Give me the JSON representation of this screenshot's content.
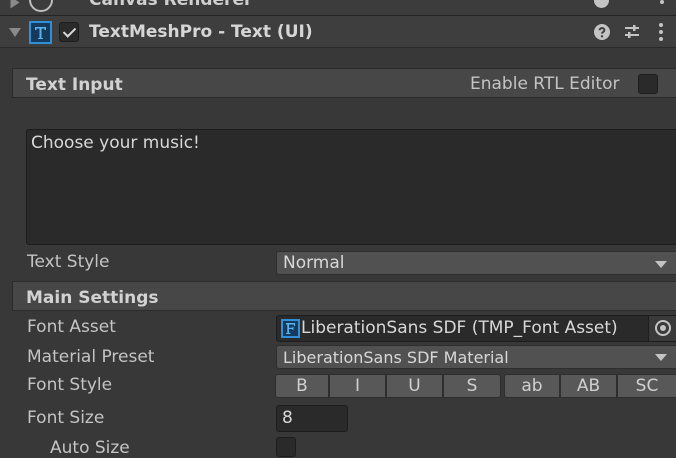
{
  "top_component": {
    "title": "Canvas Renderer"
  },
  "component": {
    "title": "TextMeshPro - Text (UI)",
    "enabled": true,
    "icons": [
      "foldout-arrow-icon",
      "tmp-text-icon",
      "help-icon",
      "presets-icon",
      "kebab-menu-icon"
    ]
  },
  "text_input": {
    "section_title": "Text Input",
    "rtl_label": "Enable RTL Editor",
    "rtl_enabled": false,
    "text_value": "Choose your music!",
    "text_style_label": "Text Style",
    "text_style_value": "Normal"
  },
  "main_settings": {
    "section_title": "Main Settings",
    "font_asset_label": "Font Asset",
    "font_asset_value": "LiberationSans SDF (TMP_Font Asset)",
    "material_preset_label": "Material Preset",
    "material_preset_value": "LiberationSans SDF Material",
    "font_style_label": "Font Style",
    "font_style_options": [
      "B",
      "I",
      "U",
      "S",
      "ab",
      "AB",
      "SC"
    ],
    "font_size_label": "Font Size",
    "font_size_value": "8",
    "auto_size_label": "Auto Size",
    "auto_size_enabled": false
  },
  "colors": {
    "background": "#383838",
    "section": "#474747",
    "field": "#2a2a2a",
    "dropdown": "#515151",
    "icon_accent": "#2f8fd8"
  }
}
